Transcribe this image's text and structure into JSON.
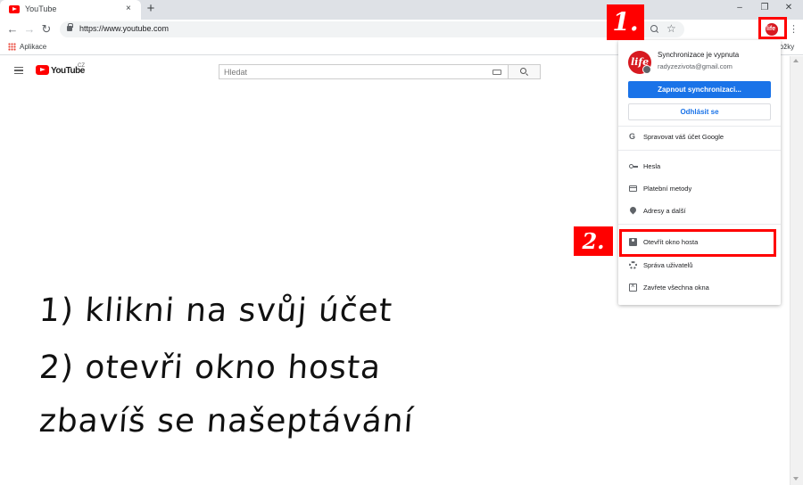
{
  "browser": {
    "tab_title": "YouTube",
    "tab_close": "×",
    "new_tab": "+",
    "window_controls": {
      "minimize": "–",
      "restore": "❐",
      "close": "✕"
    },
    "nav": {
      "back": "←",
      "forward": "→",
      "reload": "↻"
    },
    "url": "https://www.youtube.com",
    "menu": "⋮",
    "bookmarks": {
      "apps_label": "Aplikace",
      "other_bookmarks": "ložky"
    },
    "star": "☆"
  },
  "youtube": {
    "logo_text": "YouTube",
    "country_code": "CZ",
    "search_placeholder": "Hledat"
  },
  "profile_avatar_text": "life",
  "annotations": {
    "step1": "1.",
    "step2": "2.",
    "color": "#ff0000"
  },
  "profile_menu": {
    "avatar_text": "life",
    "sync_status": "Synchronizace je vypnuta",
    "email": "radyzezivota@gmail.com",
    "sync_button": "Zapnout synchronizaci...",
    "signout_button": "Odhlásit se",
    "items": [
      {
        "label": "Spravovat váš účet Google",
        "icon": "google-icon"
      },
      {
        "label": "Hesla",
        "icon": "key-icon"
      },
      {
        "label": "Platební metody",
        "icon": "credit-card-icon"
      },
      {
        "label": "Adresy a další",
        "icon": "location-pin-icon"
      },
      {
        "label": "Otevřít okno hosta",
        "icon": "guest-icon"
      },
      {
        "label": "Správa uživatelů",
        "icon": "gear-icon"
      },
      {
        "label": "Zavřete všechna okna",
        "icon": "close-windows-icon"
      }
    ],
    "accent_color": "#1a73e8"
  },
  "instructions": [
    "1) klikni na svůj účet",
    "2) otevři okno hosta",
    "zbavíš se našeptávání"
  ]
}
